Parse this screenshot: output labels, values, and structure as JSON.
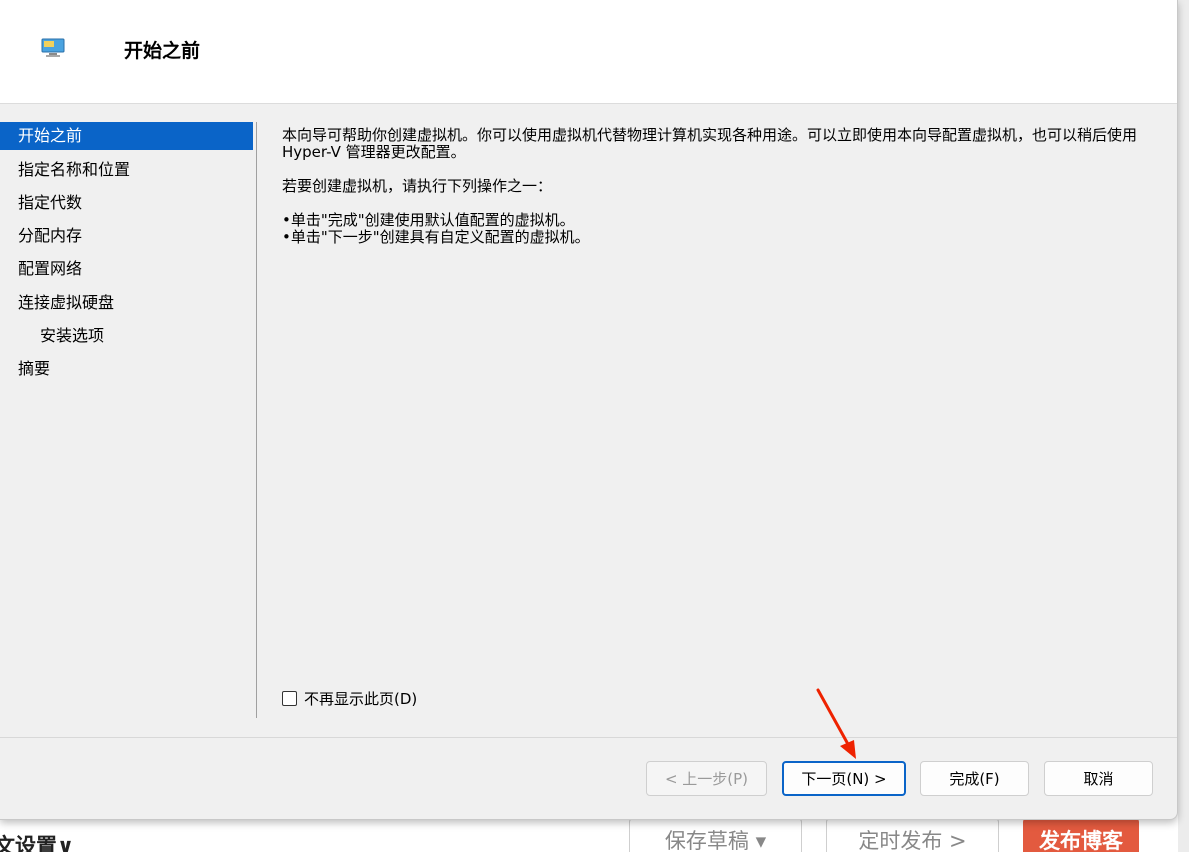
{
  "dialog": {
    "title": "开始之前",
    "nav": [
      {
        "label": "开始之前",
        "active": true
      },
      {
        "label": "指定名称和位置"
      },
      {
        "label": "指定代数"
      },
      {
        "label": "分配内存"
      },
      {
        "label": "配置网络"
      },
      {
        "label": "连接虚拟硬盘"
      },
      {
        "label": "安装选项",
        "indent": true
      },
      {
        "label": "摘要"
      }
    ],
    "content": {
      "intro": "本向导可帮助你创建虚拟机。你可以使用虚拟机代替物理计算机实现各种用途。可以立即使用本向导配置虚拟机，也可以稍后使用 Hyper-V 管理器更改配置。",
      "instruction": "若要创建虚拟机，请执行下列操作之一：",
      "bullets": [
        "•单击\"完成\"创建使用默认值配置的虚拟机。",
        "•单击\"下一步\"创建具有自定义配置的虚拟机。"
      ]
    },
    "checkbox_label": "不再显示此页(D)",
    "buttons": {
      "prev": "< 上一步(P)",
      "next": "下一页(N) >",
      "finish": "完成(F)",
      "cancel": "取消"
    }
  },
  "background": {
    "settings_label": "文设置∨",
    "draft_button": "保存草稿 ▾",
    "schedule_button": "定时发布 >",
    "publish_button": "发布博客"
  },
  "colors": {
    "accent": "#0a64c8",
    "arrow": "#ee2200",
    "publish": "#e35a3f"
  }
}
